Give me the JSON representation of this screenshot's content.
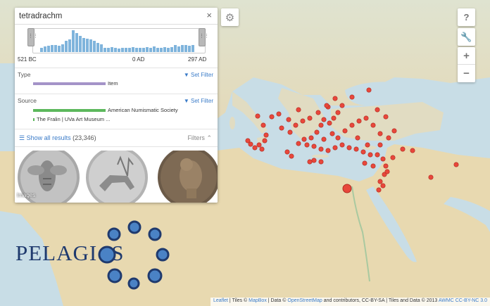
{
  "search": {
    "value": "tetradrachm",
    "clear_label": "×"
  },
  "timeline": {
    "start_label": "521 BC",
    "mid_label": "0 AD",
    "end_label": "297 AD",
    "histogram": [
      0.18,
      0.25,
      0.28,
      0.3,
      0.32,
      0.28,
      0.33,
      0.5,
      0.55,
      0.98,
      0.85,
      0.72,
      0.62,
      0.6,
      0.55,
      0.5,
      0.42,
      0.35,
      0.2,
      0.18,
      0.22,
      0.18,
      0.17,
      0.19,
      0.2,
      0.18,
      0.22,
      0.18,
      0.2,
      0.19,
      0.22,
      0.2,
      0.25,
      0.18,
      0.2,
      0.23,
      0.2,
      0.22,
      0.3,
      0.25,
      0.3,
      0.32,
      0.28,
      0.3
    ]
  },
  "facets": {
    "type": {
      "title": "Type",
      "set_filter": "Set Filter",
      "items": [
        {
          "label": "Item",
          "fraction": 1.0,
          "color": "#a493c8"
        }
      ]
    },
    "source": {
      "title": "Source",
      "set_filter": "Set Filter",
      "items": [
        {
          "label": "American Numismatic Society",
          "fraction": 1.0,
          "color": "#5cb85c"
        },
        {
          "label": "The Fralin | UVa Art Museum ...",
          "fraction": 0.01,
          "color": "#5cb85c"
        }
      ]
    }
  },
  "results": {
    "link_label": "Show all results",
    "count": "(23,346)",
    "filters_label": "Filters"
  },
  "images": {
    "label": "Images"
  },
  "controls": {
    "help_icon": "?",
    "settings_icon": "⚙",
    "tools_icon": "🔧",
    "zoom_in": "+",
    "zoom_out": "−"
  },
  "logo": {
    "text": "PELAGI S"
  },
  "attribution": {
    "leaflet": "Leaflet",
    "tiles_prefix": " | Tiles © ",
    "mapbox": "MapBox",
    "data_prefix": " | Data © ",
    "osm": "OpenStreetMap",
    "data_suffix": " and contributors, CC-BY-SA | Tiles and Data © 2013 ",
    "awmc": "AWMC CC-BY-NC 3.0"
  },
  "colors": {
    "accent": "#3a7bc8",
    "marker": "#e8473b",
    "logo": "#1f3a6e"
  }
}
